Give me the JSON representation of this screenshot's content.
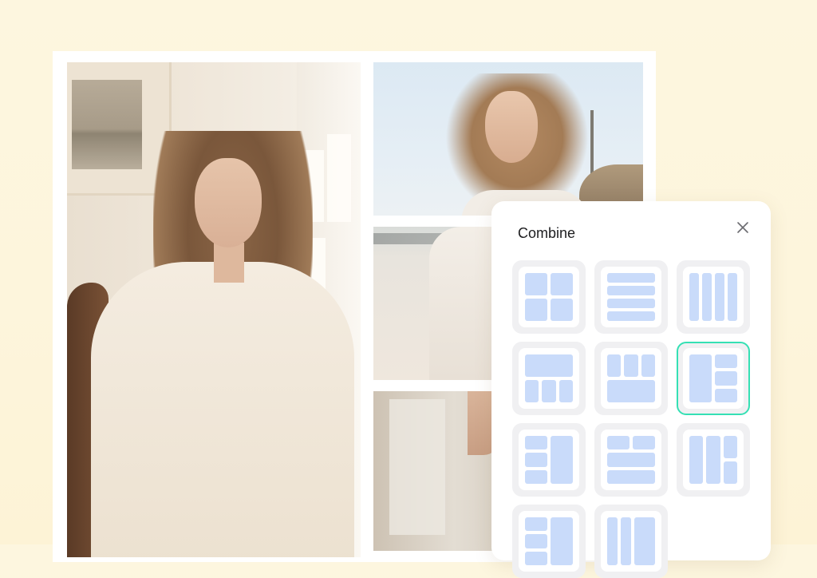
{
  "colors": {
    "background": "#fdf6df",
    "tile_bg": "#f0f0f2",
    "cell_fill": "#c9dbfa",
    "selected_border": "#35e0b4",
    "title_text": "#1d1d1f"
  },
  "collage": {
    "photos": [
      {
        "name": "photo-indoor-portrait",
        "description": "woman with long brown hair in cream blazer seated on wooden chair"
      },
      {
        "name": "photo-beach-portrait",
        "description": "woman with windswept hair at beach under blue sky"
      },
      {
        "name": "photo-beach-sweater",
        "description": "woman in white sweater on sandy beach"
      },
      {
        "name": "photo-window-portrait",
        "description": "woman near window, partially visible"
      }
    ]
  },
  "panel": {
    "title": "Combine",
    "close_icon": "close-icon",
    "selected_index": 5,
    "layouts": [
      {
        "id": "grid-2x2",
        "cells": 4
      },
      {
        "id": "rows-4",
        "cells": 4
      },
      {
        "id": "columns-4",
        "cells": 4
      },
      {
        "id": "top-wide-bottom-3",
        "cells": 4
      },
      {
        "id": "top-3-bottom-wide",
        "cells": 4
      },
      {
        "id": "left-tall-right-3",
        "cells": 4
      },
      {
        "id": "left-3-right-tall",
        "cells": 4
      },
      {
        "id": "top-2-bottom-2-wide",
        "cells": 4
      },
      {
        "id": "two-tall-right-2",
        "cells": 4
      },
      {
        "id": "left-3-right-tall-b",
        "cells": 4
      },
      {
        "id": "two-narrow-one-wide",
        "cells": 3
      }
    ]
  }
}
